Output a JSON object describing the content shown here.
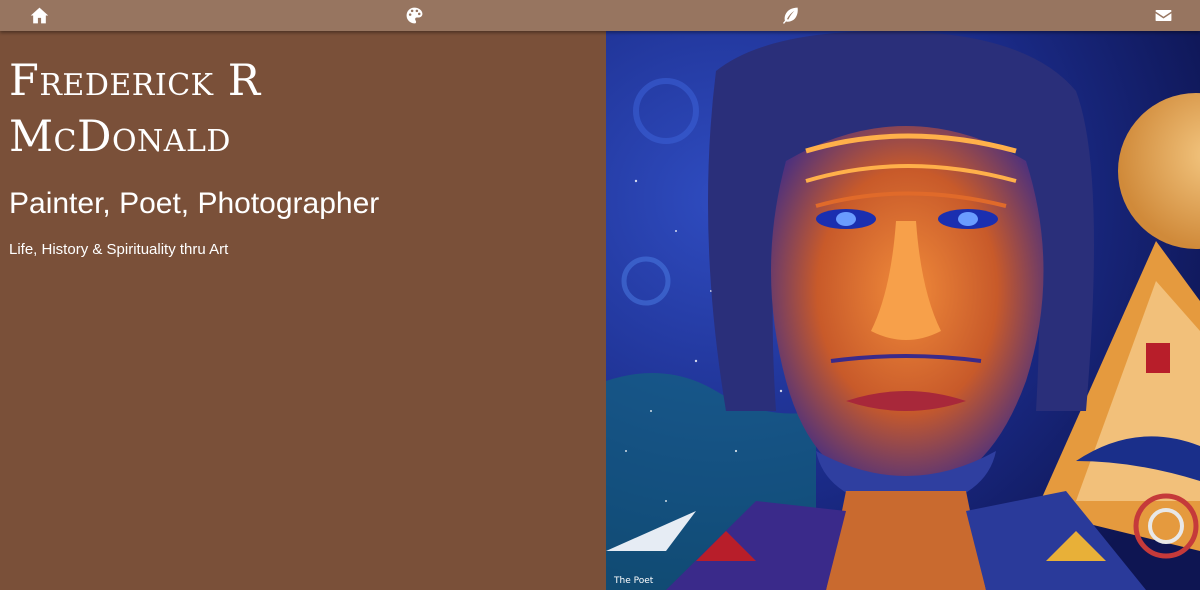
{
  "nav": {
    "items": [
      {
        "icon": "home-icon"
      },
      {
        "icon": "palette-icon"
      },
      {
        "icon": "feather-icon"
      },
      {
        "icon": "envelope-icon"
      }
    ]
  },
  "hero": {
    "name": "Frederick R McDonald",
    "tagline": "Painter, Poet, Photographer",
    "subtitle": "Life, History & Spirituality thru Art"
  },
  "painting": {
    "signature": "The Poet"
  },
  "colors": {
    "nav_bg": "#977560",
    "panel_bg": "#7a5039",
    "text": "#ffffff"
  }
}
